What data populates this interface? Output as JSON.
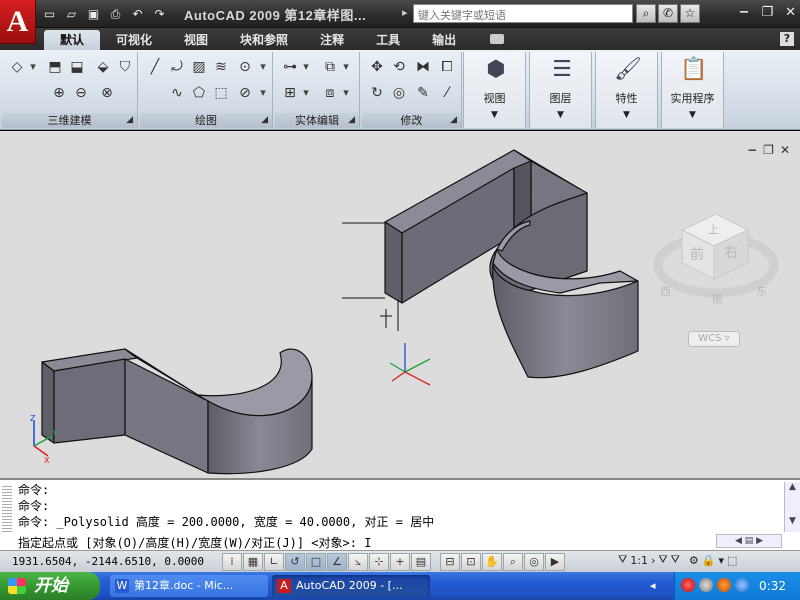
{
  "app": {
    "logo_letter": "A",
    "title": "AutoCAD 2009  第12章样图...",
    "search_placeholder": "键入关键字或短语"
  },
  "qat": [
    "new-icon",
    "open-icon",
    "save-icon",
    "plot-icon",
    "undo-icon",
    "redo-icon"
  ],
  "tabs": [
    "默认",
    "可视化",
    "视图",
    "块和参照",
    "注释",
    "工具",
    "输出"
  ],
  "active_tab": "默认",
  "panels": {
    "modeling": "三维建模",
    "draw": "绘图",
    "solid_edit": "实体编辑",
    "modify": "修改"
  },
  "big_buttons": {
    "view": "视图",
    "layers": "图层",
    "properties": "特性",
    "utilities": "实用程序"
  },
  "viewcube": {
    "top": "上",
    "front": "前",
    "right": "右",
    "south": "南",
    "west": "西",
    "east": "东"
  },
  "wcs_label": "WCS",
  "command": {
    "line1": "命令:",
    "line2": "命令:",
    "line3": "命令: _Polysolid 高度 = 200.0000, 宽度 = 40.0000, 对正 = 居中",
    "prompt": "指定起点或 [对象(O)/高度(H)/宽度(W)/对正(J)] <对象>:"
  },
  "status": {
    "coordinates": "1931.6504, -2144.6510, 0.0000",
    "annotation_scale": "1:1"
  },
  "taskbar": {
    "start": "开始",
    "task1": "第12章.doc - Mic...",
    "task2": "AutoCAD 2009 - [...",
    "clock": "0:32"
  },
  "colors": {
    "accent_red": "#c81b1b",
    "viewport_bg": "#dcdcdc",
    "solid_face": "#7c7c88",
    "taskbar_blue": "#245ed6"
  }
}
